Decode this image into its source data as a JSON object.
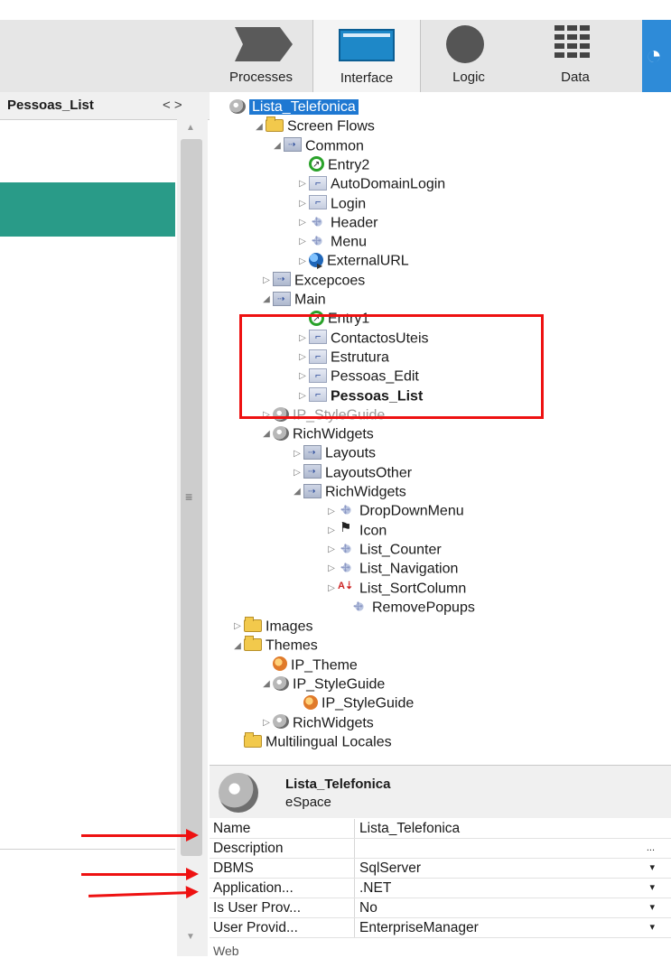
{
  "toolbar": {
    "tabs": [
      {
        "label": "Processes",
        "icon": "processes-icon"
      },
      {
        "label": "Interface",
        "icon": "interface-icon",
        "active": true
      },
      {
        "label": "Logic",
        "icon": "logic-icon"
      },
      {
        "label": "Data",
        "icon": "data-icon"
      }
    ],
    "accent_color": "#2e8bd8"
  },
  "left_panel": {
    "title": "Pessoas_List",
    "nav_arrows": "< >"
  },
  "tree": {
    "nodes": [
      {
        "label": "Lista_Telefonica",
        "icon": "espace-icon"
      },
      {
        "label": "Screen Flows",
        "icon": "folder-icon"
      },
      {
        "label": "Common",
        "icon": "flow-icon"
      },
      {
        "label": "Entry2",
        "icon": "entry-icon"
      },
      {
        "label": "AutoDomainLogin",
        "icon": "screen-icon"
      },
      {
        "label": "Login",
        "icon": "screen-icon"
      },
      {
        "label": "Header",
        "icon": "block-icon"
      },
      {
        "label": "Menu",
        "icon": "block-icon"
      },
      {
        "label": "ExternalURL",
        "icon": "external-url-icon"
      },
      {
        "label": "Excepcoes",
        "icon": "flow-icon"
      },
      {
        "label": "Main",
        "icon": "flow-icon"
      },
      {
        "label": "Entry1",
        "icon": "entry-icon"
      },
      {
        "label": "ContactosUteis",
        "icon": "screen-icon"
      },
      {
        "label": "Estrutura",
        "icon": "screen-icon"
      },
      {
        "label": "Pessoas_Edit",
        "icon": "screen-icon"
      },
      {
        "label": "Pessoas_List",
        "icon": "screen-icon"
      },
      {
        "label": "IP_StyleGuide",
        "icon": "espace-icon"
      },
      {
        "label": "RichWidgets",
        "icon": "espace-icon"
      },
      {
        "label": "Layouts",
        "icon": "flow-icon"
      },
      {
        "label": "LayoutsOther",
        "icon": "flow-icon"
      },
      {
        "label": "RichWidgets",
        "icon": "flow-icon"
      },
      {
        "label": "DropDownMenu",
        "icon": "block-icon"
      },
      {
        "label": "Icon",
        "icon": "flag-icon"
      },
      {
        "label": "List_Counter",
        "icon": "block-icon"
      },
      {
        "label": "List_Navigation",
        "icon": "block-icon"
      },
      {
        "label": "List_SortColumn",
        "icon": "sort-icon"
      },
      {
        "label": "RemovePopups",
        "icon": "block-icon"
      },
      {
        "label": "Images",
        "icon": "folder-icon"
      },
      {
        "label": "Themes",
        "icon": "folder-icon"
      },
      {
        "label": "IP_Theme",
        "icon": "theme-icon"
      },
      {
        "label": "IP_StyleGuide",
        "icon": "espace-icon"
      },
      {
        "label": "IP_StyleGuide",
        "icon": "theme-icon"
      },
      {
        "label": "RichWidgets",
        "icon": "espace-icon"
      },
      {
        "label": "Multilingual Locales",
        "icon": "folder-icon"
      }
    ]
  },
  "properties": {
    "title": "Lista_Telefonica",
    "subtitle": "eSpace",
    "rows": [
      {
        "key": "Name",
        "value": "Lista_Telefonica"
      },
      {
        "key": "Description",
        "value": "",
        "button": "..."
      },
      {
        "key": "DBMS",
        "value": "SqlServer",
        "button": "▾"
      },
      {
        "key": "Application...",
        "value": ".NET",
        "button": "▾"
      },
      {
        "key": "Is User Prov...",
        "value": "No",
        "button": "▾"
      },
      {
        "key": "User Provid...",
        "value": "EnterpriseManager",
        "button": "▾"
      }
    ],
    "footer": "Web"
  }
}
